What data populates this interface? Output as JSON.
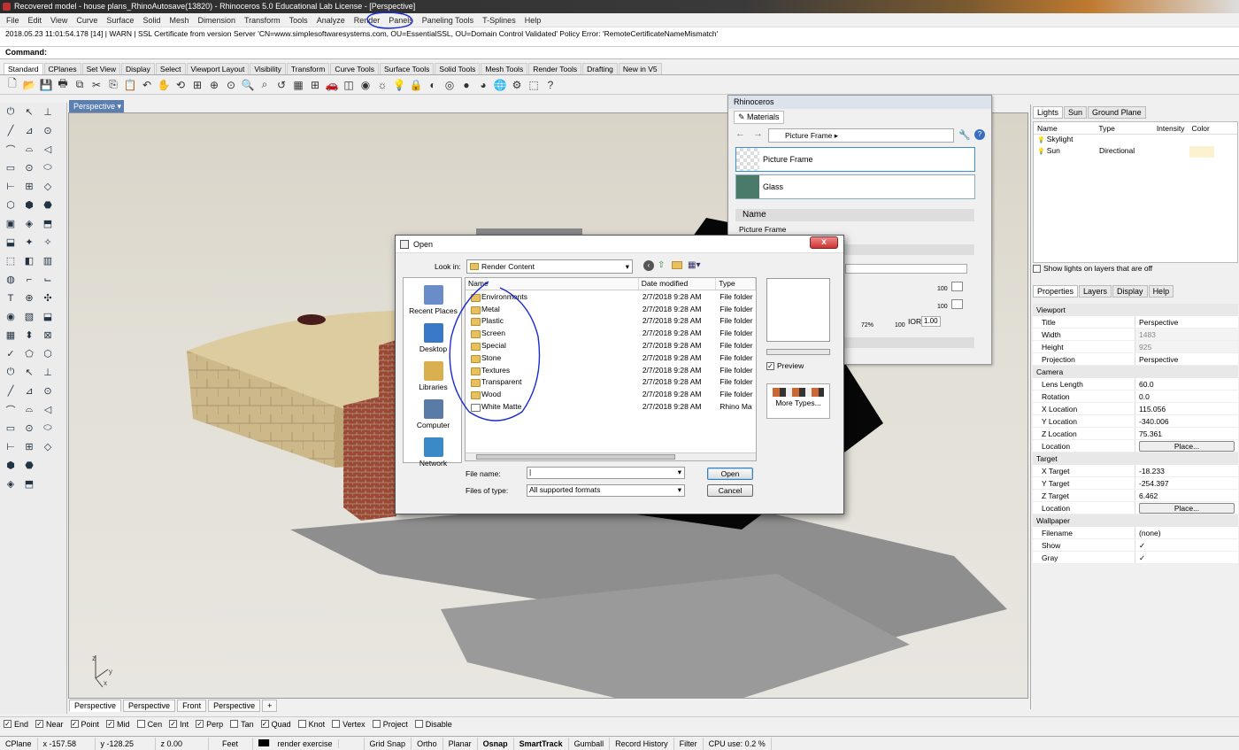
{
  "window": {
    "title": "Recovered model - house plans_RhinoAutosave(13820) - Rhinoceros 5.0 Educational Lab License - [Perspective]"
  },
  "menu": [
    "File",
    "Edit",
    "View",
    "Curve",
    "Surface",
    "Solid",
    "Mesh",
    "Dimension",
    "Transform",
    "Tools",
    "Analyze",
    "Render",
    "Panels",
    "Paneling Tools",
    "T-Splines",
    "Help"
  ],
  "history": "2018.05.23 11:01:54.178 [14] | WARN | SSL Certificate from version Server 'CN=www.simplesoftwaresystems.com, OU=EssentialSSL, OU=Domain Control Validated' Policy Error: 'RemoteCertificateNameMismatch'",
  "command_label": "Command:",
  "toolbar_tabs": [
    "Standard",
    "CPlanes",
    "Set View",
    "Display",
    "Select",
    "Viewport Layout",
    "Visibility",
    "Transform",
    "Curve Tools",
    "Surface Tools",
    "Solid Tools",
    "Mesh Tools",
    "Render Tools",
    "Drafting",
    "New in V5"
  ],
  "toolbar_icons": [
    "new-icon",
    "open-icon",
    "save-icon",
    "print-icon",
    "export-icon",
    "cut-icon",
    "copy-icon",
    "paste-icon",
    "undo-icon",
    "pan-icon",
    "rotate-view-icon",
    "zoom-window-icon",
    "zoom-extents-icon",
    "zoom-selected-icon",
    "zoom-icon",
    "zoom-dynamic-icon",
    "undo-view-icon",
    "four-view-icon",
    "grid-icon",
    "car-icon",
    "cplane-icon",
    "layer-icon",
    "light-icon",
    "bulb-icon",
    "lock-icon",
    "shade-icon",
    "color-wheel-icon",
    "sphere-icon",
    "render-sphere-icon",
    "globe-icon",
    "options-icon",
    "select-icon",
    "help-icon"
  ],
  "viewport": {
    "active_label": "Perspective",
    "tabs": [
      "Perspective",
      "Perspective",
      "Front",
      "Perspective",
      "+"
    ],
    "axes": {
      "x": "x",
      "y": "y",
      "z": "z"
    }
  },
  "osnap": [
    {
      "label": "End",
      "checked": true
    },
    {
      "label": "Near",
      "checked": true
    },
    {
      "label": "Point",
      "checked": true
    },
    {
      "label": "Mid",
      "checked": true
    },
    {
      "label": "Cen",
      "checked": false
    },
    {
      "label": "Int",
      "checked": true
    },
    {
      "label": "Perp",
      "checked": true
    },
    {
      "label": "Tan",
      "checked": false
    },
    {
      "label": "Quad",
      "checked": true
    },
    {
      "label": "Knot",
      "checked": false
    },
    {
      "label": "Vertex",
      "checked": false
    },
    {
      "label": "Project",
      "checked": false
    },
    {
      "label": "Disable",
      "checked": false
    }
  ],
  "status": {
    "cplane": "CPlane",
    "x": "x -157.58",
    "y": "y -128.25",
    "z": "z 0.00",
    "units": "Feet",
    "layer": "render exercise",
    "toggles": [
      "Grid Snap",
      "Ortho",
      "Planar",
      "Osnap",
      "SmartTrack",
      "Gumball",
      "Record History",
      "Filter"
    ],
    "cpu": "CPU use: 0.2 %"
  },
  "materials_panel": {
    "title": "Rhinoceros",
    "tab": "Materials",
    "breadcrumb": "Picture Frame",
    "items": [
      "Picture Frame",
      "Glass"
    ],
    "name_header": "Name",
    "name_value": "Picture Frame",
    "slider_a": "100",
    "slider_b": "100",
    "slider_pct": "72%",
    "slider_max": "100",
    "ior_label": "IOR:",
    "ior_value": "1.00"
  },
  "lights_panel": {
    "tabs": [
      "Lights",
      "Sun",
      "Ground Plane"
    ],
    "columns": [
      "Name",
      "Type",
      "Intensity",
      "Color"
    ],
    "rows": [
      {
        "name": "Skylight",
        "type": "",
        "intensity": "",
        "color": ""
      },
      {
        "name": "Sun",
        "type": "Directional",
        "intensity": "",
        "color": ""
      }
    ],
    "show_on_layers": "Show lights on layers that are off"
  },
  "properties_panel": {
    "tabs": [
      "Properties",
      "Layers",
      "Display",
      "Help"
    ],
    "sections": [
      {
        "title": "Viewport",
        "rows": [
          {
            "k": "Title",
            "v": "Perspective"
          },
          {
            "k": "Width",
            "v": "1483",
            "dim": true
          },
          {
            "k": "Height",
            "v": "925",
            "dim": true
          },
          {
            "k": "Projection",
            "v": "Perspective"
          }
        ]
      },
      {
        "title": "Camera",
        "rows": [
          {
            "k": "Lens Length",
            "v": "60.0"
          },
          {
            "k": "Rotation",
            "v": "0.0"
          },
          {
            "k": "X Location",
            "v": "115.056"
          },
          {
            "k": "Y Location",
            "v": "-340.006"
          },
          {
            "k": "Z Location",
            "v": "75.361"
          },
          {
            "k": "Location",
            "v": "Place...",
            "button": true
          }
        ]
      },
      {
        "title": "Target",
        "rows": [
          {
            "k": "X Target",
            "v": "-18.233"
          },
          {
            "k": "Y Target",
            "v": "-254.397"
          },
          {
            "k": "Z Target",
            "v": "6.462"
          },
          {
            "k": "Location",
            "v": "Place...",
            "button": true
          }
        ]
      },
      {
        "title": "Wallpaper",
        "rows": [
          {
            "k": "Filename",
            "v": "(none)"
          },
          {
            "k": "Show",
            "v": "✓"
          },
          {
            "k": "Gray",
            "v": "✓"
          }
        ]
      }
    ]
  },
  "open_dialog": {
    "title": "Open",
    "close": "x",
    "look_in_label": "Look in:",
    "look_in_value": "Render Content",
    "places": [
      "Recent Places",
      "Desktop",
      "Libraries",
      "Computer",
      "Network"
    ],
    "columns": [
      "Name",
      "Date modified",
      "Type"
    ],
    "files": [
      {
        "name": "Environments",
        "date": "2/7/2018 9:28 AM",
        "type": "File folder",
        "folder": true
      },
      {
        "name": "Metal",
        "date": "2/7/2018 9:28 AM",
        "type": "File folder",
        "folder": true
      },
      {
        "name": "Plastic",
        "date": "2/7/2018 9:28 AM",
        "type": "File folder",
        "folder": true
      },
      {
        "name": "Screen",
        "date": "2/7/2018 9:28 AM",
        "type": "File folder",
        "folder": true
      },
      {
        "name": "Special",
        "date": "2/7/2018 9:28 AM",
        "type": "File folder",
        "folder": true
      },
      {
        "name": "Stone",
        "date": "2/7/2018 9:28 AM",
        "type": "File folder",
        "folder": true
      },
      {
        "name": "Textures",
        "date": "2/7/2018 9:28 AM",
        "type": "File folder",
        "folder": true
      },
      {
        "name": "Transparent",
        "date": "2/7/2018 9:28 AM",
        "type": "File folder",
        "folder": true
      },
      {
        "name": "Wood",
        "date": "2/7/2018 9:28 AM",
        "type": "File folder",
        "folder": true
      },
      {
        "name": "White Matte",
        "date": "2/7/2018 9:28 AM",
        "type": "Rhino Ma",
        "folder": false
      }
    ],
    "preview_label": "Preview",
    "more_types": "More Types...",
    "file_name_label": "File name:",
    "file_name_value": "",
    "file_type_label": "Files of type:",
    "file_type_value": "All supported formats",
    "open_button": "Open",
    "cancel_button": "Cancel"
  }
}
